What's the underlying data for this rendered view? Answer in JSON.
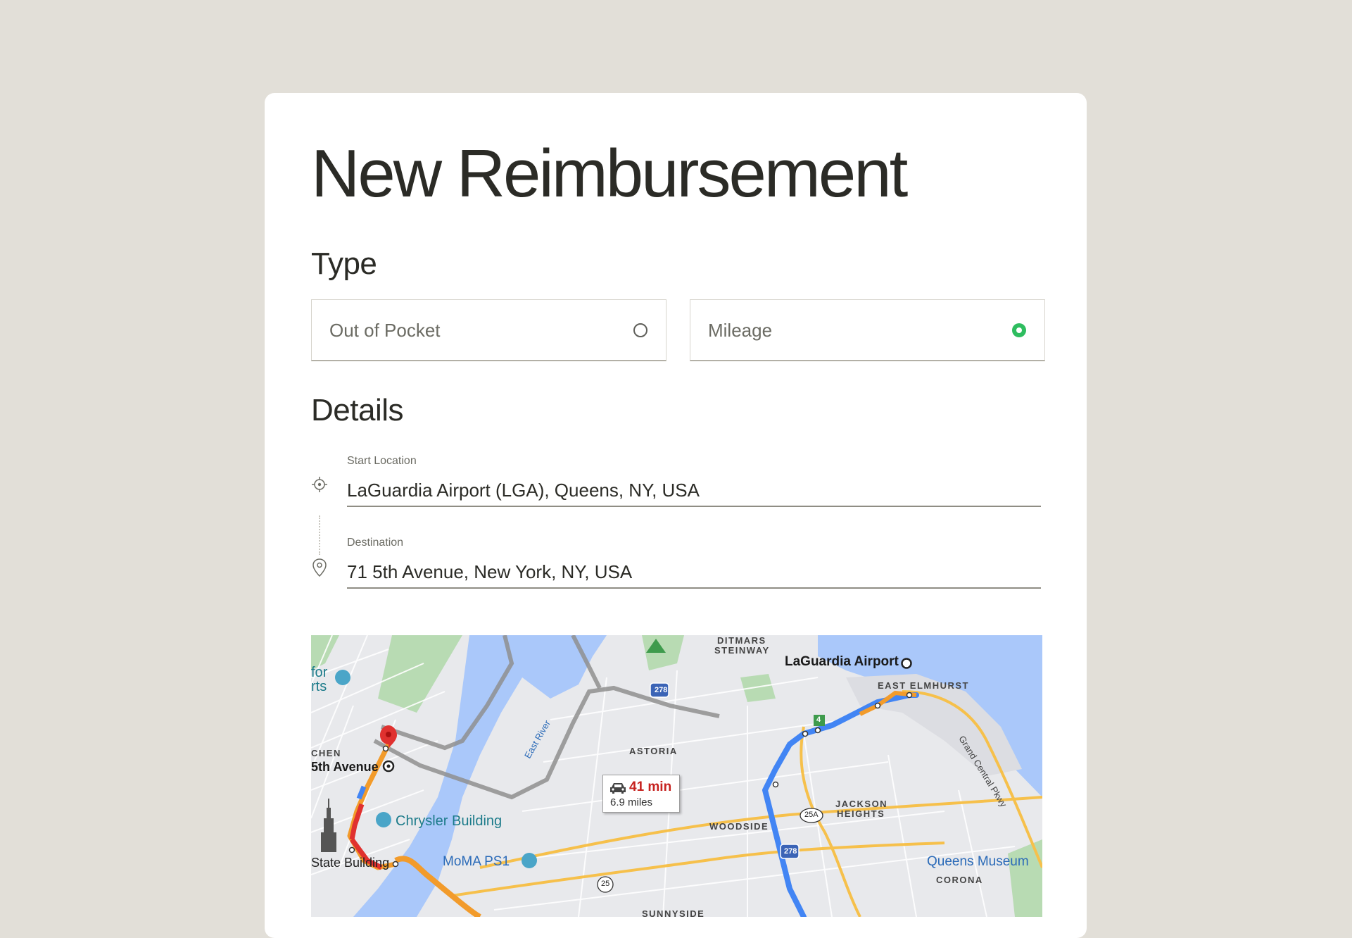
{
  "page": {
    "title": "New Reimbursement"
  },
  "type_section": {
    "heading": "Type",
    "options": [
      {
        "label": "Out of Pocket",
        "selected": false
      },
      {
        "label": "Mileage",
        "selected": true
      }
    ]
  },
  "details_section": {
    "heading": "Details",
    "start_location": {
      "label": "Start Location",
      "value": "LaGuardia Airport (LGA), Queens, NY, USA",
      "icon": "crosshair-icon"
    },
    "destination": {
      "label": "Destination",
      "value": "71 5th Avenue, New York, NY, USA",
      "icon": "map-pin-icon"
    }
  },
  "map": {
    "route_time": "41 min",
    "route_distance": "6.9 miles",
    "labels": {
      "laguardia": "LaGuardia Airport",
      "ditmars": "DITMARS",
      "steinway": "STEINWAY",
      "east_elmhurst": "EAST ELMHURST",
      "astoria": "ASTORIA",
      "woodside": "WOODSIDE",
      "jackson": "JACKSON",
      "heights": "HEIGHTS",
      "sunnyside": "SUNNYSIDE",
      "corona": "CORONA",
      "queens_museum": "Queens Museum",
      "chrysler": "Chrysler Building",
      "moma": "MoMA PS1",
      "fifth_avenue": "5th Avenue",
      "chen": "CHEN",
      "state_building": "State Building",
      "for": "for",
      "rts": "rts",
      "east_river": "East River",
      "grand_central": "Grand Central Pkwy",
      "shield_278a": "278",
      "shield_278b": "278",
      "shield_25a": "25A",
      "shield_25": "25",
      "shield_4": "4"
    },
    "colors": {
      "water": "#aac8fa",
      "park": "#b8dbb3",
      "route_blue": "#4285f4",
      "route_orange": "#f29b2b",
      "route_red": "#e0312f",
      "alt_route": "#9a9a9a",
      "highway": "#f6c04b"
    }
  },
  "colors": {
    "background": "#e2dfd8",
    "card": "#ffffff",
    "selected_radio": "#2ebd5f",
    "text": "#2b2b26"
  }
}
